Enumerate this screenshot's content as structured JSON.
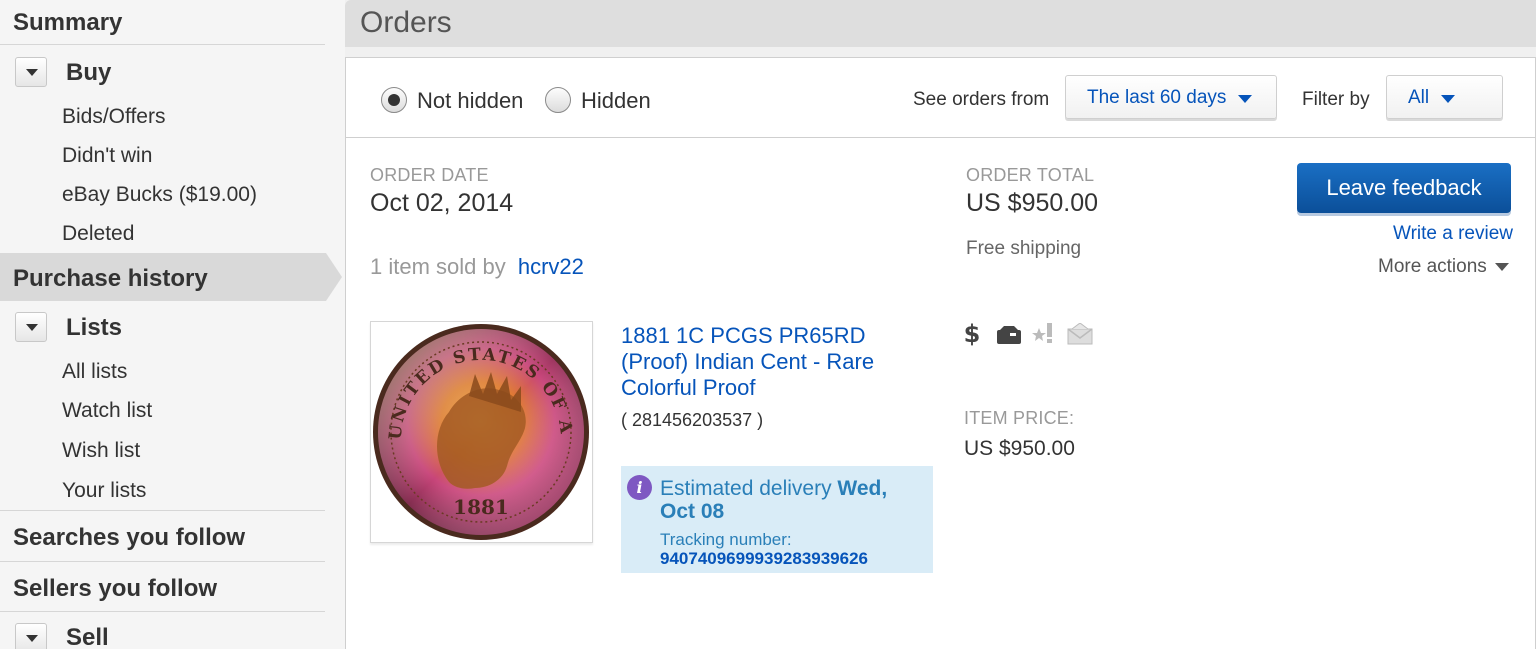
{
  "sidebar": {
    "summary": "Summary",
    "buy": {
      "title": "Buy",
      "items": [
        "Bids/Offers",
        "Didn't win",
        "eBay Bucks ($19.00)",
        "Deleted"
      ]
    },
    "purchase_history": "Purchase history",
    "lists": {
      "title": "Lists",
      "items": [
        "All lists",
        "Watch list",
        "Wish list",
        "Your lists"
      ]
    },
    "searches_you_follow": "Searches you follow",
    "sellers_you_follow": "Sellers you follow",
    "sell": {
      "title": "Sell"
    }
  },
  "header": {
    "title": "Orders"
  },
  "filters": {
    "visibility": [
      {
        "label": "Not hidden",
        "checked": true
      },
      {
        "label": "Hidden",
        "checked": false
      }
    ],
    "see_orders_label": "See orders from",
    "see_orders_value": "The last 60 days",
    "filter_by_label": "Filter by",
    "filter_by_value": "All"
  },
  "order": {
    "date_caption": "ORDER DATE",
    "date_value": "Oct 02, 2014",
    "total_caption": "ORDER TOTAL",
    "total_value": "US $950.00",
    "shipping": "Free shipping",
    "sold_by_prefix": "1 item sold by",
    "seller": "hcrv22",
    "leave_feedback": "Leave feedback",
    "write_review": "Write a review",
    "more_actions": "More actions",
    "status_icons": [
      "dollar-icon",
      "shipped-box-icon",
      "feedback-star-icon",
      "envelope-icon"
    ],
    "item": {
      "title": "1881 1C PCGS PR65RD (Proof) Indian Cent - Rare Colorful Proof",
      "id": "( 281456203537 )",
      "price_caption": "ITEM PRICE:",
      "price_value": "US $950.00",
      "coin_year": "1881",
      "coin_legend": "UNITED STATES OF AMERICA"
    },
    "delivery": {
      "prefix": "Estimated delivery",
      "date": "Wed, Oct 08",
      "tracking_label": "Tracking number:",
      "tracking_number": "9407409699939283939626"
    }
  },
  "colors": {
    "link": "#0654ba",
    "button": "#0b5aa8",
    "delivery_bg": "#d9ecf7",
    "info_icon": "#7e58c2"
  }
}
